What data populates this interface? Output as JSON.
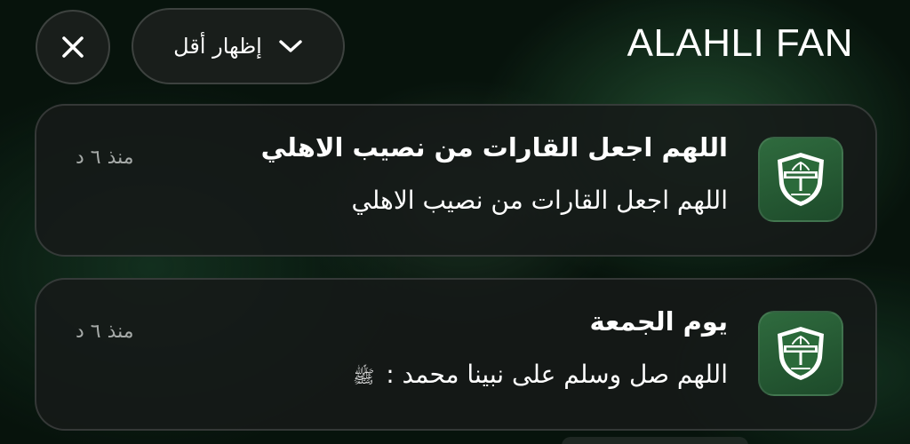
{
  "header": {
    "title": "ALAHLI FAN",
    "show_less_label": "إظهار أقل"
  },
  "notifications": [
    {
      "title": "اللهم اجعل القارات من نصيب الاهلي",
      "body": "اللهم اجعل القارات من نصيب الاهلي",
      "time": "منذ ٦ د"
    },
    {
      "title": "يوم الجمعة",
      "body": "اللهم صل وسلم على نبينا محمد :",
      "body_symbol": "ﷺ",
      "time": "منذ ٦ د"
    }
  ],
  "colors": {
    "background": "#07130c",
    "card_background": "#161a18",
    "icon_green": "#2f6b3e",
    "time_text": "#a6aaa8"
  },
  "icons": {
    "close": "close-icon",
    "chevron": "chevron-down-icon",
    "app": "alahli-club-logo-icon"
  }
}
